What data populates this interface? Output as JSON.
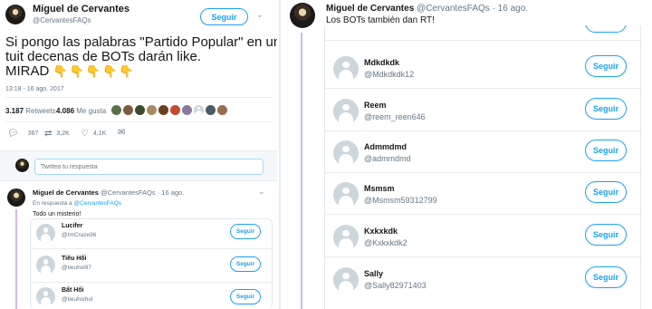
{
  "left": {
    "tweet": {
      "author_name": "Miguel de Cervantes",
      "author_handle": "@CervantesFAQs",
      "follow_label": "Seguir",
      "text_line1": "Si pongo las palabras \"Partido Popular\" en un",
      "text_line2": "tuit decenas de BOTs darán like.",
      "text_line3": "MIRAD",
      "emoji": "👇👇👇👇👇",
      "timestamp": "13:18 - 16 ago. 2017",
      "retweets_count": "3.187",
      "retweets_label": "Retweets",
      "likes_count": "4.086",
      "likes_label": "Me gusta",
      "reply_count": "367",
      "rt_count": "3,2K",
      "like_count": "4,1K"
    },
    "reply_box": {
      "placeholder": "Twittea tu respuesta"
    },
    "reply": {
      "author_name": "Miguel de Cervantes",
      "author_handle": "@CervantesFAQs",
      "date": "· 16 ago.",
      "in_reply_prefix": "En respuesta a",
      "in_reply_handle": "@CervantesFAQs",
      "text": "Todo un misterio!",
      "users": [
        {
          "name": "Lucifer",
          "handle": "@ImCraze96",
          "follow": "Seguir"
        },
        {
          "name": "Tiêu Hối",
          "handle": "@tieuhoi97",
          "follow": "Seguir"
        },
        {
          "name": "Bất Hối",
          "handle": "@tieuhoihoi",
          "follow": "Seguir"
        }
      ]
    }
  },
  "right": {
    "tweet": {
      "author_name": "Miguel de Cervantes",
      "author_handle": "@CervantesFAQs",
      "date": "· 16 ago.",
      "text": "Los BOTs también dan RT!"
    },
    "users": [
      {
        "name": "Mdkdkdk",
        "handle": "@Mdkdkdk12",
        "follow": "Seguir"
      },
      {
        "name": "Reem",
        "handle": "@reem_reen646",
        "follow": "Seguir"
      },
      {
        "name": "Admmdmd",
        "handle": "@admmdmd",
        "follow": "Seguir"
      },
      {
        "name": "Msmsm",
        "handle": "@Msmsm59312799",
        "follow": "Seguir"
      },
      {
        "name": "Kxkxkdk",
        "handle": "@Kxkxkdk2",
        "follow": "Seguir"
      },
      {
        "name": "Sally",
        "handle": "@Sally82971403",
        "follow": "Seguir"
      }
    ]
  },
  "colors": {
    "accent": "#1da1f2",
    "muted": "#657786",
    "border": "#e1e8ed",
    "thread_line": "#d2b9e8"
  }
}
